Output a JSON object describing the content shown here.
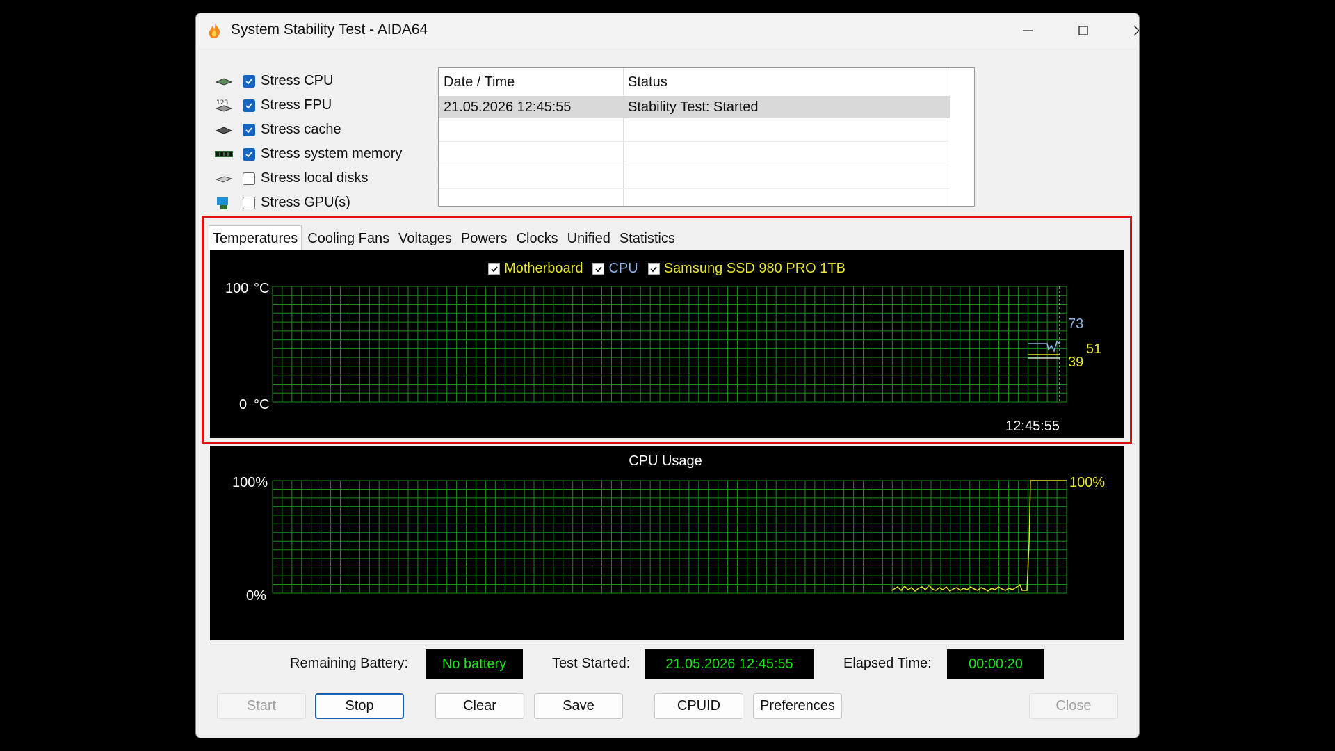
{
  "window": {
    "title": "System Stability Test - AIDA64"
  },
  "stress_options": [
    {
      "label": "Stress CPU",
      "checked": true,
      "icon": "cpu-chip-icon"
    },
    {
      "label": "Stress FPU",
      "checked": true,
      "icon": "fpu-numbers-icon"
    },
    {
      "label": "Stress cache",
      "checked": true,
      "icon": "cache-chip-icon"
    },
    {
      "label": "Stress system memory",
      "checked": true,
      "icon": "memory-module-icon"
    },
    {
      "label": "Stress local disks",
      "checked": false,
      "icon": "disk-drive-icon"
    },
    {
      "label": "Stress GPU(s)",
      "checked": false,
      "icon": "gpu-icon"
    }
  ],
  "log": {
    "columns": [
      "Date / Time",
      "Status"
    ],
    "rows": [
      {
        "datetime": "21.05.2026 12:45:55",
        "status": "Stability Test: Started"
      }
    ]
  },
  "tabs": [
    "Temperatures",
    "Cooling Fans",
    "Voltages",
    "Powers",
    "Clocks",
    "Unified",
    "Statistics"
  ],
  "active_tab": "Temperatures",
  "temperature_graph": {
    "legend": [
      {
        "label": "Motherboard",
        "color": "#e6e62a"
      },
      {
        "label": "CPU",
        "color": "#8fb3e6"
      },
      {
        "label": "Samsung SSD 980 PRO 1TB",
        "color": "#e6e62a"
      }
    ],
    "y_max_label": "100",
    "y_min_label": "0",
    "unit": "°C",
    "time_label": "12:45:55",
    "readouts": [
      {
        "value": "73",
        "color": "#8fb3e6"
      },
      {
        "value": "51",
        "color": "#e6e62a"
      },
      {
        "value": "39",
        "color": "#e6e62a"
      }
    ]
  },
  "cpu_graph": {
    "title": "CPU Usage",
    "y_max_label": "100%",
    "y_min_label": "0%",
    "readout": "100%",
    "color": "#e6e62a"
  },
  "status": {
    "battery_label": "Remaining Battery:",
    "battery_value": "No battery",
    "started_label": "Test Started:",
    "started_value": "21.05.2026 12:45:55",
    "elapsed_label": "Elapsed Time:",
    "elapsed_value": "00:00:20"
  },
  "buttons": {
    "start": "Start",
    "stop": "Stop",
    "clear": "Clear",
    "save": "Save",
    "cpuid": "CPUID",
    "preferences": "Preferences",
    "close": "Close"
  },
  "colors": {
    "grid": "#1e8c1e",
    "status_text": "#19e619",
    "highlight": "#e01010"
  }
}
